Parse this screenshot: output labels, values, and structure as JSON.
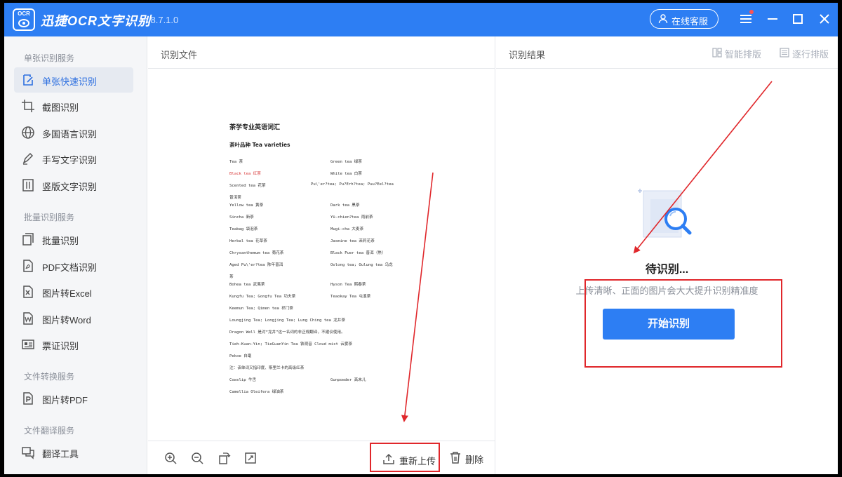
{
  "app": {
    "logo_text": "OCR",
    "title": "迅捷OCR文字识别",
    "version": "v8.7.1.0",
    "service_label": "在线客服"
  },
  "sidebar": {
    "sections": [
      {
        "title": "单张识别服务",
        "items": [
          {
            "label": "单张快速识别",
            "icon": "quick-scan-icon",
            "active": true
          },
          {
            "label": "截图识别",
            "icon": "crop-icon"
          },
          {
            "label": "多国语言识别",
            "icon": "globe-icon"
          },
          {
            "label": "手写文字识别",
            "icon": "pen-icon"
          },
          {
            "label": "竖版文字识别",
            "icon": "vertical-text-icon"
          }
        ]
      },
      {
        "title": "批量识别服务",
        "items": [
          {
            "label": "批量识别",
            "icon": "batch-icon"
          },
          {
            "label": "PDF文档识别",
            "icon": "pdf-icon"
          },
          {
            "label": "图片转Excel",
            "icon": "excel-icon"
          },
          {
            "label": "图片转Word",
            "icon": "word-icon"
          },
          {
            "label": "票证识别",
            "icon": "id-card-icon"
          }
        ]
      },
      {
        "title": "文件转换服务",
        "items": [
          {
            "label": "图片转PDF",
            "icon": "pdf-convert-icon"
          }
        ]
      },
      {
        "title": "文件翻译服务",
        "items": [
          {
            "label": "翻译工具",
            "icon": "translate-icon"
          }
        ]
      }
    ]
  },
  "center": {
    "header": "识别文件",
    "document": {
      "title": "茶学专业英语词汇",
      "subtitle": "茶叶品种 Tea varieties",
      "lines": [
        {
          "left": "Tea 茶",
          "right": "Green tea 绿茶"
        },
        {
          "left": "Black tea 红茶",
          "right": "White tea  白茶",
          "red": true
        },
        {
          "left": "Scented tea 花茶",
          "right": "Pu\\'er?tea; Pu?Erh?tea; Puu?Eel?tea"
        },
        {
          "left": "普洱茶",
          "right": ""
        },
        {
          "left": "Yellow tea 黄茶",
          "right": "Dark tea 黑茶"
        },
        {
          "left": "Sincha 新茶",
          "right": "Yü-chien?tea 雨前茶"
        },
        {
          "left": "Teabag 袋泡茶",
          "right": "Mugi-cha 大麦茶"
        },
        {
          "left": "Herbal tea 花草茶",
          "right": "Jasmine tea 茉莉花茶"
        },
        {
          "left": "Chrysanthemum tea 菊花茶",
          "right": "Black Puer tea 普洱（熟）"
        },
        {
          "left": "Aged Pu\\'er?tea 陈年普洱",
          "right": "Oolong tea; Oulung tea 乌龙"
        },
        {
          "left": "茶",
          "right": ""
        },
        {
          "left": "Bohea tea 武夷茶",
          "right": "Hyson Tea 熙春茶"
        },
        {
          "left": "Kungfu Tea; Gongfu Tea 功夫茶",
          "right": "Teaokay Tea 屯溪茶"
        },
        {
          "left": "Keemun Tea; Qimen tea 祁门茶",
          "right": ""
        },
        {
          "left": "Loungjing Tea;  Longjing Tea; Lung Ching tea 龙井茶",
          "right": ""
        },
        {
          "left": "     Dragon Well 是对“龙井”这一名词的非正规翻译，不建议使用。",
          "right": ""
        },
        {
          "left": "Tieh-Kuan-Yin; TieGuanYin Tea 铁观音    Cloud mist 云雾茶",
          "right": ""
        },
        {
          "left": "Pekoe 白毫",
          "right": ""
        },
        {
          "left": "     注：该单词又指印度、斯里兰卡的高级红茶",
          "right": ""
        },
        {
          "left": "Cowslip 牛舌",
          "right": "Gunpowder 高末儿"
        },
        {
          "left": "Camellia Oleifera 绿油茶",
          "right": ""
        }
      ]
    },
    "toolbar": {
      "zoom_in": "zoom-in-icon",
      "zoom_out": "zoom-out-icon",
      "rotate": "rotate-icon",
      "fit": "fit-screen-icon",
      "reupload_label": "重新上传",
      "delete_label": "删除"
    }
  },
  "result": {
    "header": "识别结果",
    "smart_layout": "智能排版",
    "line_layout": "逐行排版",
    "status": "待识别...",
    "hint": "上传清晰、正面的图片会大大提升识别精准度",
    "start_label": "开始识别"
  },
  "colors": {
    "primary": "#2d7ef3",
    "annotation_red": "#e0272b",
    "sidebar_bg": "#f5f6f8"
  }
}
